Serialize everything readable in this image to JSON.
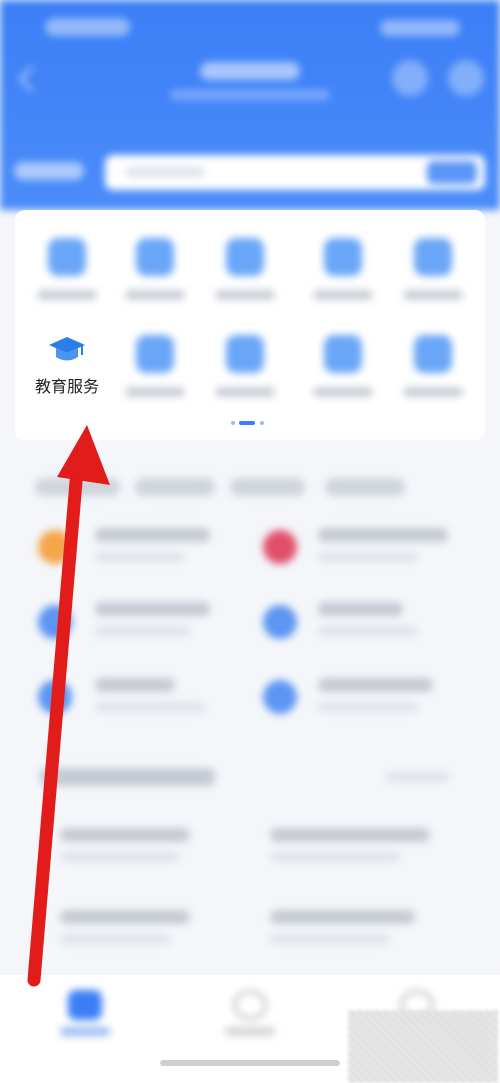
{
  "services": {
    "highlighted": {
      "label": "教育服务",
      "icon": "graduation-cap-icon",
      "color": "#2b7de9"
    }
  },
  "colors": {
    "header_blue": "#3b7ef6",
    "arrow_red": "#e21b1b"
  }
}
